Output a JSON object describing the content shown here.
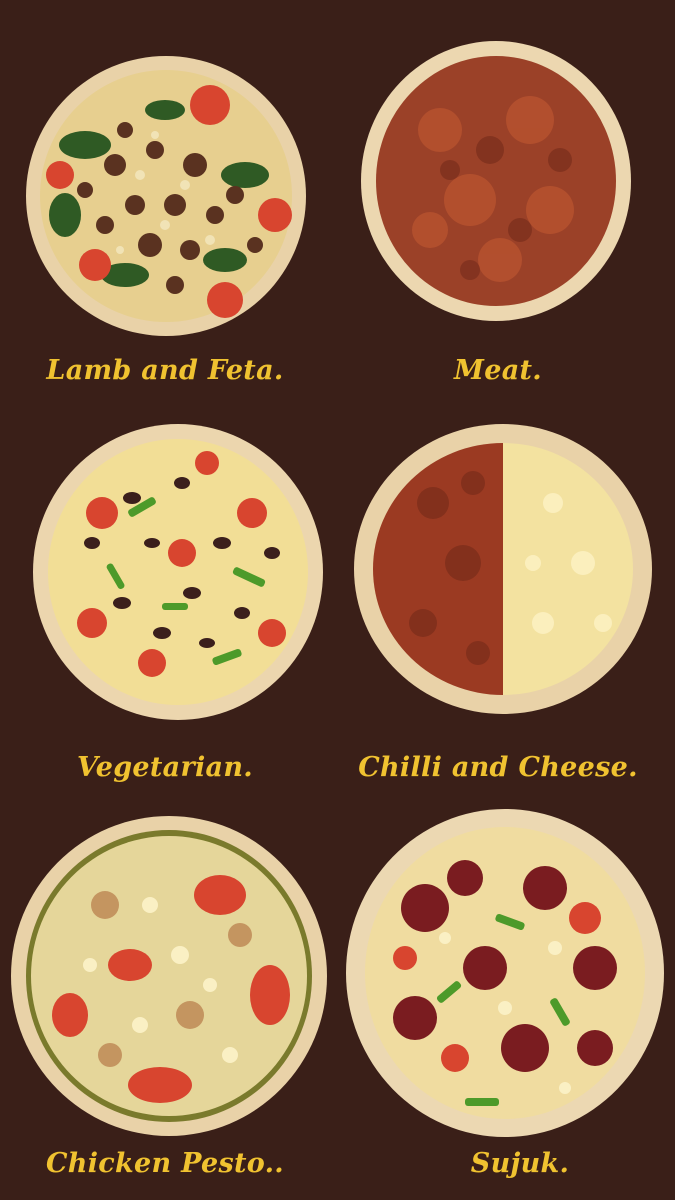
{
  "menu": {
    "items": [
      {
        "name": "Lamb and Feta."
      },
      {
        "name": "Meat."
      },
      {
        "name": "Vegetarian."
      },
      {
        "name": "Chilli and Cheese."
      },
      {
        "name": "Chicken Pesto.."
      },
      {
        "name": "Sujuk."
      }
    ]
  },
  "colors": {
    "background": "#3a1f18",
    "label": "#f0c230",
    "crust": "#e9d2a8",
    "cheese": "#f3e2a0",
    "meat": "#8a3a22",
    "tomato": "#d8452f",
    "spinach": "#2f5a24",
    "olive": "#3b1f1c",
    "pepper_green": "#4d9a2a",
    "pesto": "#7a7a2c",
    "sujuk": "#7a1c20"
  },
  "icons": [
    "lamb-feta-pizza-image",
    "meat-pizza-image",
    "vegetarian-pizza-image",
    "chilli-cheese-pizza-image",
    "chicken-pesto-pizza-image",
    "sujuk-pizza-image"
  ]
}
